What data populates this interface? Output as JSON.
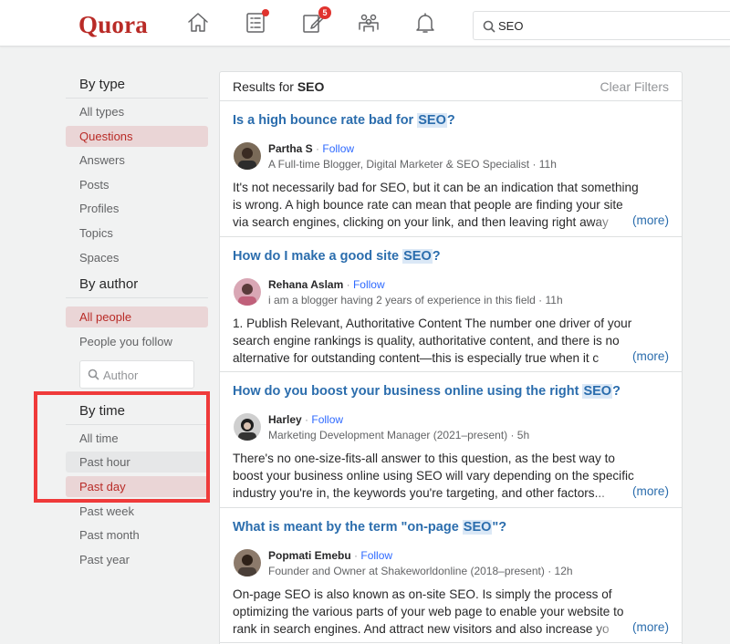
{
  "header": {
    "logo": "Quora",
    "notifications_badge": "5",
    "search_value": "SEO"
  },
  "sidebar": {
    "by_type_title": "By type",
    "types": [
      "All types",
      "Questions",
      "Answers",
      "Posts",
      "Profiles",
      "Topics",
      "Spaces"
    ],
    "by_author_title": "By author",
    "authors": [
      "All people",
      "People you follow"
    ],
    "author_search_placeholder": "Author",
    "by_time_title": "By time",
    "times": [
      "All time",
      "Past hour",
      "Past day",
      "Past week",
      "Past month",
      "Past year"
    ]
  },
  "results": {
    "label": "Results for",
    "query": "SEO",
    "clear_filters": "Clear Filters",
    "items": [
      {
        "title_pre": "Is a high bounce rate bad for ",
        "title_hl": "SEO",
        "title_post": "?",
        "author": "Partha S",
        "follow": "Follow",
        "credential": "A Full-time Blogger, Digital Marketer & SEO Specialist · 11h",
        "line1": "It's not necessarily bad for SEO, but it can be an indication that something",
        "line2": "is wrong. A high bounce rate can mean that people are finding your site",
        "line3": "via search engines, clicking on your link, and then leaving right away",
        "more": "(more)"
      },
      {
        "title_pre": "How do I make a good site ",
        "title_hl": "SEO",
        "title_post": "?",
        "author": "Rehana Aslam",
        "follow": "Follow",
        "credential": "i am a blogger having 2 years of experience in this field · 11h",
        "line1": "1. Publish Relevant, Authoritative Content The number one driver of your",
        "line2": "search engine rankings is quality, authoritative content, and there is no",
        "line3": "alternative for outstanding content—this is especially true when it c",
        "more": "(more)"
      },
      {
        "title_pre": "How do you boost your business online using the right ",
        "title_hl": "SEO",
        "title_post": "?",
        "author": "Harley",
        "follow": "Follow",
        "credential": "Marketing Development Manager (2021–present) · 5h",
        "line1": "There's no one-size-fits-all answer to this question, as the best way to",
        "line2": "boost your business online using SEO will vary depending on the specific",
        "line3": "industry you're in, the keywords you're targeting, and other factors...",
        "more": "(more)"
      },
      {
        "title_pre": "What is meant by the term \"on-page ",
        "title_hl": "SEO",
        "title_post": "\"?",
        "author": "Popmati Emebu",
        "follow": "Follow",
        "credential": "Founder and Owner at Shakeworldonline (2018–present) · 12h",
        "line1": "On-page SEO is also known as on-site SEO. Is simply the process of",
        "line2": "optimizing the various parts of your web page to enable your website to",
        "line3": "rank in search engines. And attract new visitors and also increase yo",
        "more": "(more)"
      }
    ]
  },
  "colors": {
    "brand": "#b92b27",
    "link": "#2b6dad",
    "follow": "#2e69ff",
    "highlight_frame": "#ef3a3a"
  }
}
